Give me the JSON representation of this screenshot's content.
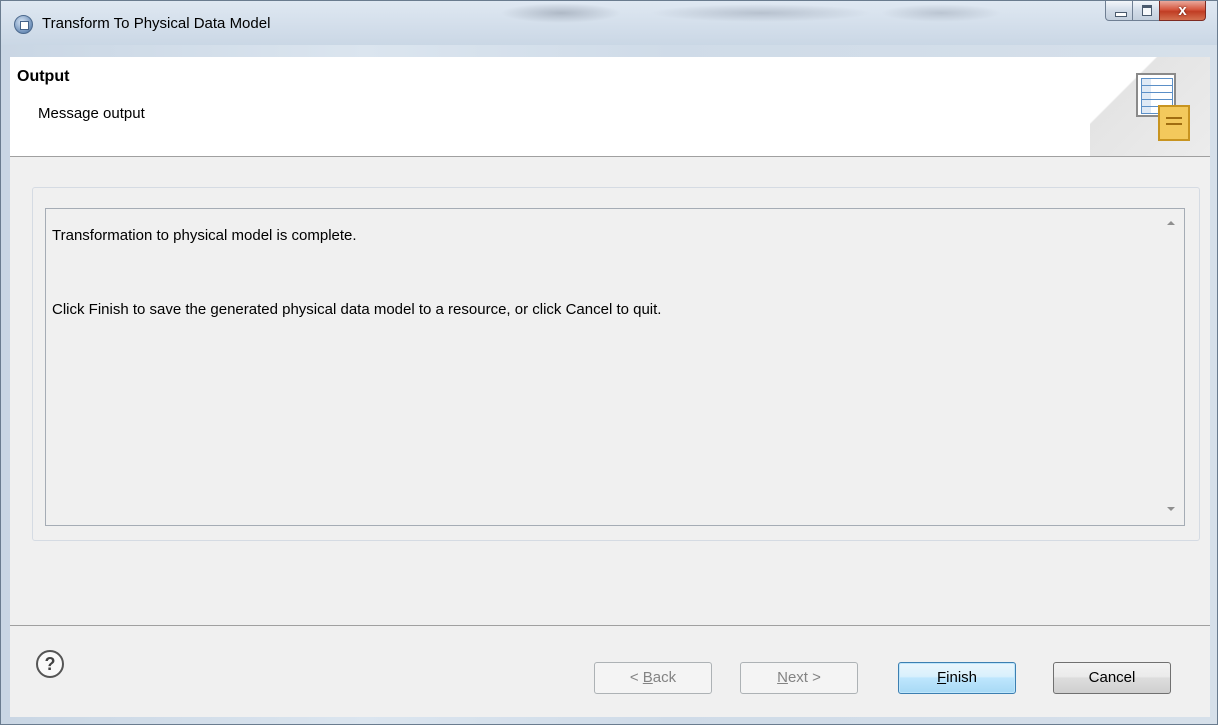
{
  "window": {
    "title": "Transform To Physical Data Model",
    "close_glyph": "x"
  },
  "header": {
    "title": "Output",
    "message": "Message output",
    "image_icon": "data-model-wizard-icon"
  },
  "output": {
    "text": "Transformation to physical model is complete.\n\nClick Finish to save the generated physical data model to a resource, or click Cancel to quit."
  },
  "footer": {
    "help_icon": "help-icon",
    "help_glyph": "?",
    "back_label_pre": "< ",
    "back_label_mnemonic": "B",
    "back_label_post": "ack",
    "next_label_mnemonic": "N",
    "next_label_post": "ext >",
    "finish_label_mnemonic": "F",
    "finish_label_post": "inish",
    "cancel_label": "Cancel"
  },
  "colors": {
    "default_button": "#3c7fb1",
    "close_button": "#c03d24"
  }
}
